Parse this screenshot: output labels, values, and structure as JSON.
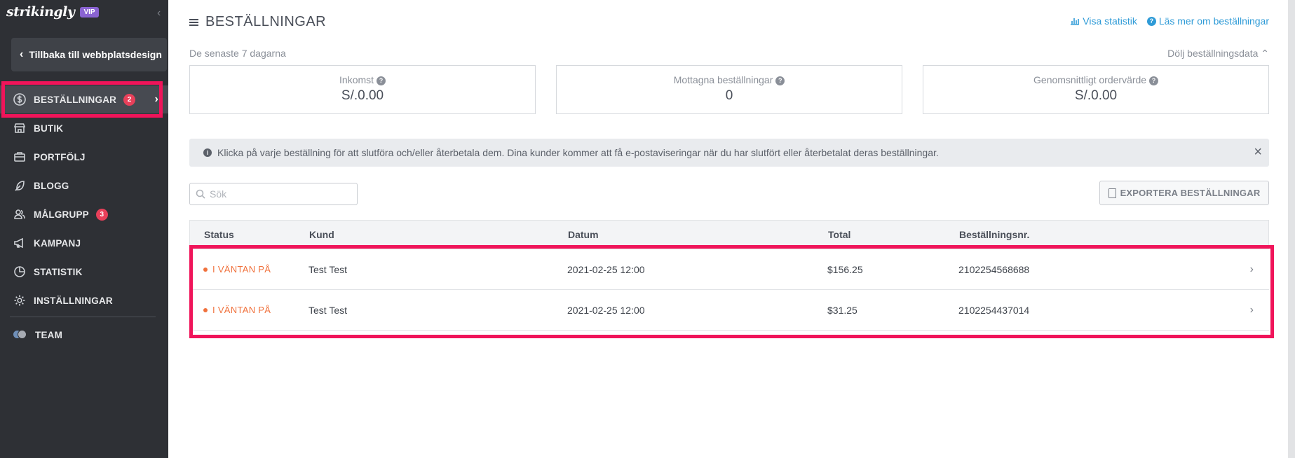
{
  "sidebar": {
    "brand": "strikingly",
    "vip": "VIP",
    "back_label": "Tillbaka till webbplatsdesign",
    "items": [
      {
        "label": "BESTÄLLNINGAR",
        "badge": "2",
        "icon": "dollar-circle-icon"
      },
      {
        "label": "BUTIK",
        "icon": "store-icon"
      },
      {
        "label": "PORTFÖLJ",
        "icon": "briefcase-icon"
      },
      {
        "label": "BLOGG",
        "icon": "feather-icon"
      },
      {
        "label": "MÅLGRUPP",
        "badge": "3",
        "icon": "users-icon"
      },
      {
        "label": "KAMPANJ",
        "icon": "megaphone-icon"
      },
      {
        "label": "STATISTIK",
        "icon": "pie-chart-icon"
      },
      {
        "label": "INSTÄLLNINGAR",
        "icon": "gear-icon"
      },
      {
        "label": "TEAM",
        "icon": "team-avatars-icon"
      }
    ]
  },
  "header": {
    "title": "BESTÄLLNINGAR",
    "link_stats": "Visa statistik",
    "link_learn": "Läs mer om beställningar",
    "range": "De senaste 7 dagarna",
    "hide": "Dölj beställningsdata"
  },
  "stats": [
    {
      "label": "Inkomst",
      "value": "S/.0.00"
    },
    {
      "label": "Mottagna beställningar",
      "value": "0"
    },
    {
      "label": "Genomsnittligt ordervärde",
      "value": "S/.0.00"
    }
  ],
  "notice": "Klicka på varje beställning för att slutföra och/eller återbetala dem. Dina kunder kommer att få e-postaviseringar när du har slutfört eller återbetalat deras beställningar.",
  "search": {
    "placeholder": "Sök"
  },
  "export_label": "EXPORTERA BESTÄLLNINGAR",
  "table": {
    "columns": [
      "Status",
      "Kund",
      "Datum",
      "Total",
      "Beställningsnr."
    ],
    "rows": [
      {
        "status": "I VÄNTAN PÅ",
        "customer": "Test Test",
        "date": "2021-02-25 12:00",
        "total": "$156.25",
        "order_no": "2102254568688"
      },
      {
        "status": "I VÄNTAN PÅ",
        "customer": "Test Test",
        "date": "2021-02-25 12:00",
        "total": "$31.25",
        "order_no": "2102254437014"
      }
    ]
  },
  "colors": {
    "sidebar_bg": "#2e3035",
    "accent": "#2f9bd7",
    "pending": "#f0713c",
    "highlight": "#f0145a",
    "badge": "#e8405a"
  }
}
